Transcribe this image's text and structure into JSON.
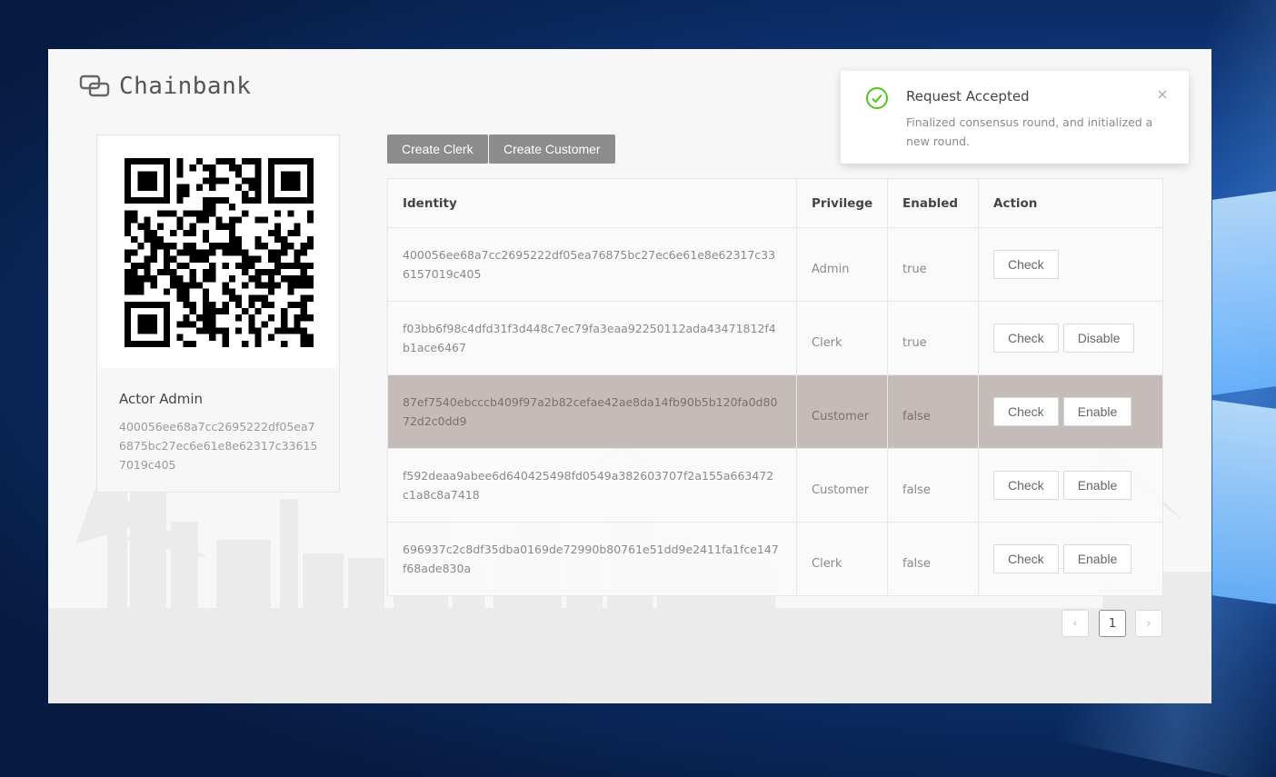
{
  "app": {
    "title": "Chainbank"
  },
  "toolbar": {
    "create_clerk": "Create Clerk",
    "create_customer": "Create Customer"
  },
  "profile": {
    "name": "Actor Admin",
    "identity": "400056ee68a7cc2695222df05ea76875bc27ec6e61e8e62317c336157019c405"
  },
  "table": {
    "headers": [
      "Identity",
      "Privilege",
      "Enabled",
      "Action"
    ],
    "rows": [
      {
        "identity": "400056ee68a7cc2695222df05ea76875bc27ec6e61e8e62317c336157019c405",
        "privilege": "Admin",
        "enabled": "true",
        "actions": [
          "Check"
        ]
      },
      {
        "identity": "f03bb6f98c4dfd31f3d448c7ec79fa3eaa92250112ada43471812f4b1ace6467",
        "privilege": "Clerk",
        "enabled": "true",
        "actions": [
          "Check",
          "Disable"
        ]
      },
      {
        "identity": "87ef7540ebcccb409f97a2b82cefae42ae8da14fb90b5b120fa0d8072d2c0dd9",
        "privilege": "Customer",
        "enabled": "false",
        "actions": [
          "Check",
          "Enable"
        ],
        "highlighted": true
      },
      {
        "identity": "f592deaa9abee6d640425498fd0549a382603707f2a155a663472c1a8c8a7418",
        "privilege": "Customer",
        "enabled": "false",
        "actions": [
          "Check",
          "Enable"
        ]
      },
      {
        "identity": "696937c2c8df35dba0169de72990b80761e51dd9e2411fa1fce147f68ade830a",
        "privilege": "Clerk",
        "enabled": "false",
        "actions": [
          "Check",
          "Enable"
        ]
      }
    ]
  },
  "pagination": {
    "prev": "‹",
    "current": "1",
    "next": "›"
  },
  "notification": {
    "title": "Request Accepted",
    "message": "Finalized consensus round, and initialized a new round.",
    "close": "×",
    "icon": "check-circle-icon",
    "color": "#52c41a"
  }
}
